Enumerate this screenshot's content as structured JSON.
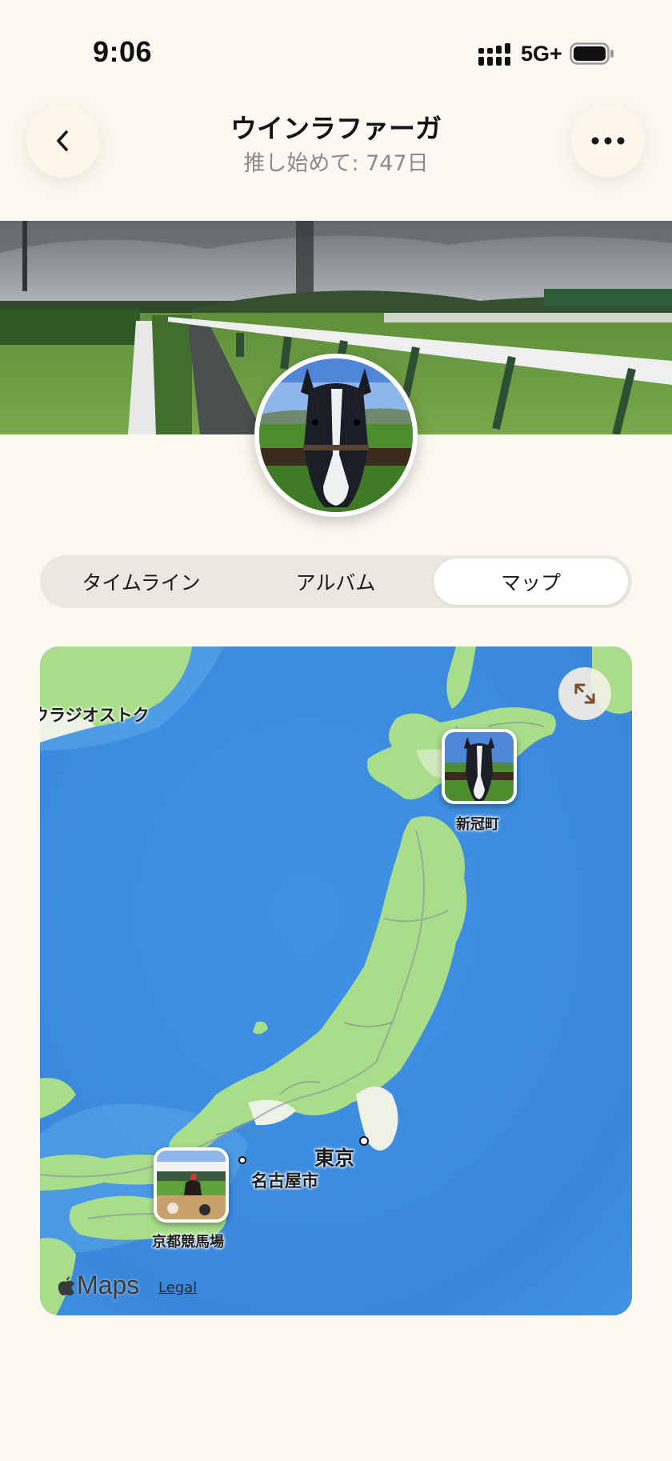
{
  "status_bar": {
    "time": "9:06",
    "network": "5G+"
  },
  "header": {
    "title": "ウインラファーガ",
    "subtitle": "推し始めて: 747日",
    "back_icon": "chevron-left-icon",
    "more_icon": "ellipsis-icon"
  },
  "tabs": [
    {
      "label": "タイムライン",
      "selected": false
    },
    {
      "label": "アルバム",
      "selected": false
    },
    {
      "label": "マップ",
      "selected": true
    }
  ],
  "map": {
    "labels": {
      "vladivostok": "ウラジオストク",
      "niikappu": "新冠町",
      "tokyo": "東京",
      "nagoya": "名古屋市",
      "kyoto_racecourse": "京都競馬場"
    },
    "attribution": {
      "brand": "Maps",
      "legal": "Legal"
    }
  },
  "colors": {
    "background": "#fcf8f1",
    "tab_track": "#ece8e1",
    "ocean": "#3d8fe0",
    "land": "#a9dd8a"
  }
}
